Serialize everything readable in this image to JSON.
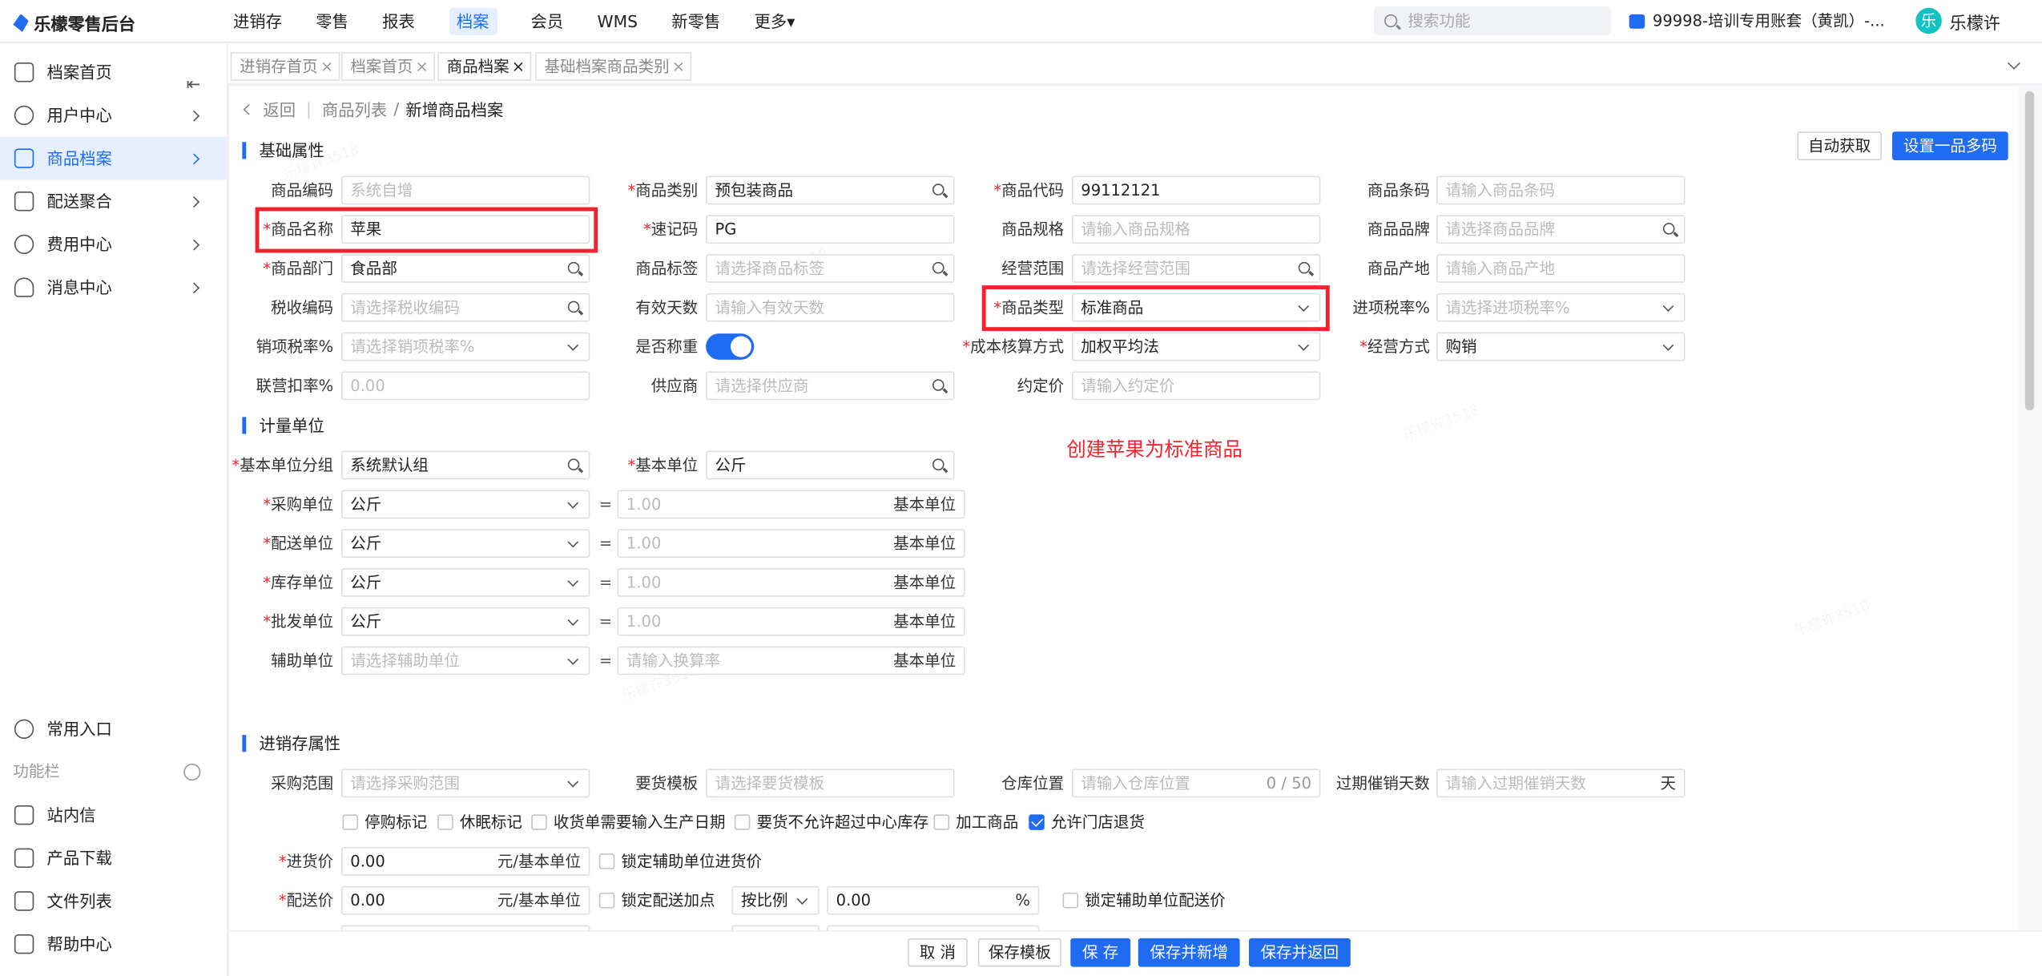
{
  "app": {
    "logo_text": "乐檬零售后台"
  },
  "topnav": [
    {
      "label": "进销存"
    },
    {
      "label": "零售"
    },
    {
      "label": "报表"
    },
    {
      "label": "档案",
      "active": true
    },
    {
      "label": "会员"
    },
    {
      "label": "WMS"
    },
    {
      "label": "新零售"
    },
    {
      "label": "更多▾"
    }
  ],
  "search": {
    "placeholder": "搜索功能"
  },
  "account": {
    "label": "99998-培训专用账套（黄凯）-..."
  },
  "user": {
    "avatar_char": "乐",
    "name": "乐檬许"
  },
  "sidebar": {
    "items": [
      {
        "label": "档案首页"
      },
      {
        "label": "用户中心"
      },
      {
        "label": "商品档案",
        "active": true
      },
      {
        "label": "配送聚合"
      },
      {
        "label": "费用中心"
      },
      {
        "label": "消息中心"
      }
    ],
    "common": "常用入口",
    "section": "功能栏",
    "bottom": [
      {
        "label": "站内信"
      },
      {
        "label": "产品下载"
      },
      {
        "label": "文件列表"
      },
      {
        "label": "帮助中心"
      }
    ]
  },
  "tabs": [
    {
      "label": "进销存首页"
    },
    {
      "label": "档案首页"
    },
    {
      "label": "商品档案",
      "active": true
    },
    {
      "label": "基础档案商品类别"
    }
  ],
  "breadcrumb": {
    "back": "返回",
    "parent": "商品列表",
    "sep": "/",
    "current": "新增商品档案"
  },
  "sections": {
    "basic": "基础属性",
    "units": "计量单位",
    "inventory": "进销存属性"
  },
  "actions": {
    "auto_fetch": "自动获取",
    "multi_code": "设置一品多码"
  },
  "form": {
    "goods_code": {
      "label": "商品编码",
      "placeholder": "系统自增"
    },
    "category": {
      "label": "商品类别",
      "value": "预包装商品"
    },
    "product_code": {
      "label": "商品代码",
      "value": "99112121"
    },
    "barcode": {
      "label": "商品条码",
      "placeholder": "请输入商品条码"
    },
    "name": {
      "label": "商品名称",
      "value": "苹果"
    },
    "mnemonic": {
      "label": "速记码",
      "value": "PG"
    },
    "spec": {
      "label": "商品规格",
      "placeholder": "请输入商品规格"
    },
    "brand": {
      "label": "商品品牌",
      "placeholder": "请选择商品品牌"
    },
    "dept": {
      "label": "商品部门",
      "value": "食品部"
    },
    "tag": {
      "label": "商品标签",
      "placeholder": "请选择商品标签"
    },
    "scope": {
      "label": "经营范围",
      "placeholder": "请选择经营范围"
    },
    "origin": {
      "label": "商品产地",
      "placeholder": "请输入商品产地"
    },
    "tax_code": {
      "label": "税收编码",
      "placeholder": "请选择税收编码"
    },
    "valid_days": {
      "label": "有效天数",
      "placeholder": "请输入有效天数"
    },
    "goods_type": {
      "label": "商品类型",
      "value": "标准商品"
    },
    "input_tax": {
      "label": "进项税率%",
      "placeholder": "请选择进项税率%"
    },
    "output_tax": {
      "label": "销项税率%",
      "placeholder": "请选择销项税率%"
    },
    "weighing": {
      "label": "是否称重"
    },
    "cost_method": {
      "label": "成本核算方式",
      "value": "加权平均法"
    },
    "biz_mode": {
      "label": "经营方式",
      "value": "购销"
    },
    "joint_rate": {
      "label": "联营扣率%",
      "placeholder": "0.00"
    },
    "supplier": {
      "label": "供应商",
      "placeholder": "请选择供应商"
    },
    "agreed_price": {
      "label": "约定价",
      "placeholder": "请输入约定价"
    }
  },
  "annotation": "创建苹果为标准商品",
  "units": {
    "base_group": {
      "label": "基本单位分组",
      "value": "系统默认组"
    },
    "base_unit": {
      "label": "基本单位",
      "value": "公斤"
    },
    "eq": "=",
    "base_suffix": "基本单位",
    "rows": [
      {
        "label": "采购单位",
        "value": "公斤",
        "ratio": "1.00",
        "required": true
      },
      {
        "label": "配送单位",
        "value": "公斤",
        "ratio": "1.00",
        "required": true
      },
      {
        "label": "库存单位",
        "value": "公斤",
        "ratio": "1.00",
        "required": true
      },
      {
        "label": "批发单位",
        "value": "公斤",
        "ratio": "1.00",
        "required": true
      },
      {
        "label": "辅助单位",
        "value": "请选择辅助单位",
        "ratio": "请输入换算率",
        "required": false
      }
    ]
  },
  "inventory": {
    "purchase_scope": {
      "label": "采购范围",
      "placeholder": "请选择采购范围"
    },
    "order_template": {
      "label": "要货模板",
      "placeholder": "请选择要货模板"
    },
    "warehouse_pos": {
      "label": "仓库位置",
      "placeholder": "请输入仓库位置",
      "counter": "0 / 50"
    },
    "expire_days": {
      "label": "过期催销天数",
      "placeholder": "请输入过期催销天数",
      "suffix": "天"
    },
    "checks": [
      {
        "label": "停购标记",
        "checked": false
      },
      {
        "label": "休眠标记",
        "checked": false
      },
      {
        "label": "收货单需要输入生产日期",
        "checked": false
      },
      {
        "label": "要货不允许超过中心库存",
        "checked": false
      },
      {
        "label": "加工商品",
        "checked": false
      },
      {
        "label": "允许门店退货",
        "checked": true
      }
    ],
    "purchase_price": {
      "label": "进货价",
      "value": "0.00",
      "suffix": "元/基本单位",
      "lock": "锁定辅助单位进货价"
    },
    "delivery_price": {
      "label": "配送价",
      "value": "0.00",
      "suffix": "元/基本单位",
      "lock": "锁定配送加点",
      "mode": "按比例",
      "percent": "0.00",
      "percent_suffix": "%",
      "lock2": "锁定辅助单位配送价"
    }
  },
  "footer": {
    "cancel": "取 消",
    "save_template": "保存模板",
    "save": "保 存",
    "save_new": "保存并新增",
    "save_return": "保存并返回"
  },
  "colors": {
    "primary": "#1f6bf2",
    "highlight": "#f5222d"
  }
}
